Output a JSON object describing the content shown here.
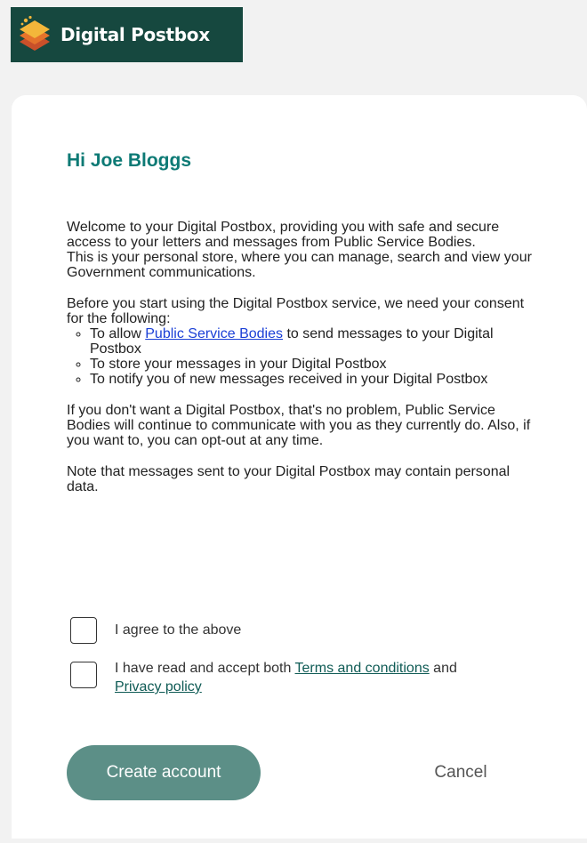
{
  "brand": {
    "name": "Digital Postbox"
  },
  "greeting": "Hi Joe Bloggs",
  "intro": {
    "p1": "Welcome to your Digital Postbox, providing you with safe and secure access to your letters and messages from Public Service Bodies.",
    "p2": "This is your personal store, where you can manage, search and view your Government communications."
  },
  "consent": {
    "lead": "Before you start using the Digital Postbox service, we need your consent for the following:",
    "item1_before": "To allow ",
    "item1_link": "Public Service Bodies",
    "item1_after": " to send messages to your Digital Postbox",
    "item2": "To store your messages in your Digital Postbox",
    "item3": "To notify you of new messages received in your Digital Postbox"
  },
  "optout": "If you don't want a Digital Postbox, that's no problem, Public Service Bodies will continue to communicate with you as they currently do. Also, if you want to, you can opt-out at any time.",
  "note": "Note that messages sent to your Digital Postbox may contain personal data.",
  "checkboxes": {
    "agree_label": "I agree to the above",
    "terms_before": "I have read and accept both ",
    "terms_link": "Terms and conditions",
    "terms_middle": " and ",
    "privacy_link": "Privacy policy"
  },
  "actions": {
    "create": "Create account",
    "cancel": "Cancel"
  }
}
